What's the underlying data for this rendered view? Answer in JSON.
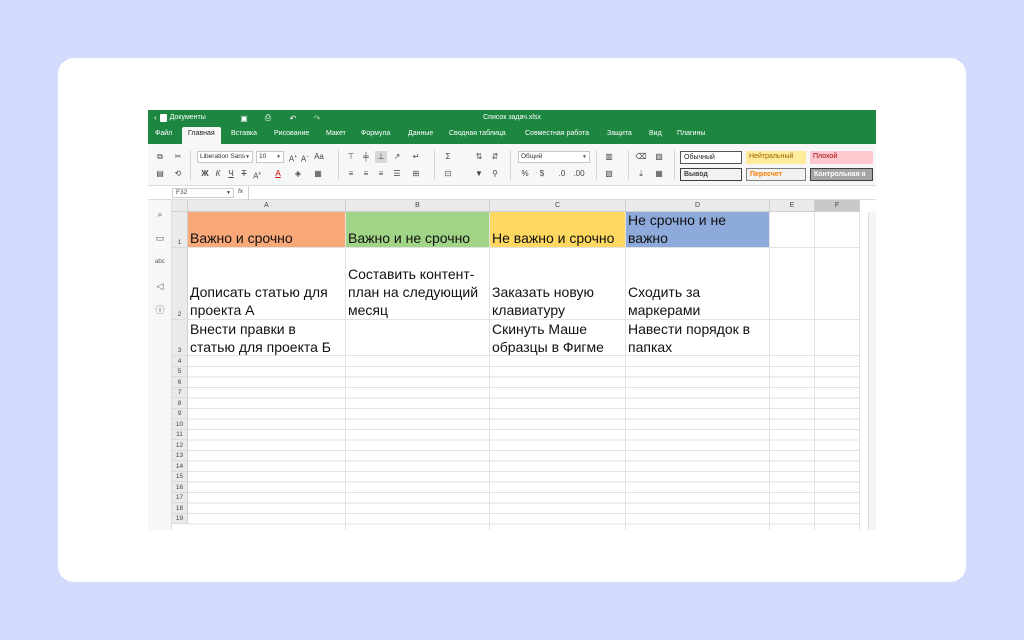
{
  "app": {
    "back_label": "Документы",
    "title": "Список задач.xlsx"
  },
  "menu": {
    "tabs": [
      "Файл",
      "Главная",
      "Вставка",
      "Рисование",
      "Макет",
      "Формула",
      "Данные",
      "Сводная таблица",
      "Совместная работа",
      "Защита",
      "Вид",
      "Плагины"
    ],
    "active_tab": "Главная"
  },
  "toolbar": {
    "font_name": "Liberation Sans",
    "font_size": "10",
    "number_format": "Общий",
    "styles": [
      {
        "label": "Обычный",
        "bg": "#ffffff",
        "fg": "#222222",
        "border": "#555555"
      },
      {
        "label": "Нейтральный",
        "bg": "#ffeb9c",
        "fg": "#9c6500",
        "border": "#ffeb9c"
      },
      {
        "label": "Плохой",
        "bg": "#ffc7ce",
        "fg": "#9c0006",
        "border": "#ffc7ce"
      },
      {
        "label": "Вывод",
        "bg": "#f2f2f2",
        "fg": "#3f3f3f",
        "border": "#3f3f3f"
      },
      {
        "label": "Пересчет",
        "bg": "#f2f2f2",
        "fg": "#fa7d00",
        "border": "#7f7f7f"
      },
      {
        "label": "Контрольная я",
        "bg": "#a5a5a5",
        "fg": "#ffffff",
        "border": "#3f3f3f"
      }
    ]
  },
  "formula_bar": {
    "cell_ref": "F32",
    "fx": "fx",
    "value": ""
  },
  "sheet": {
    "columns": [
      "A",
      "B",
      "C",
      "D",
      "E",
      "F"
    ],
    "selected_column": "F",
    "row_numbers": [
      "1",
      "2",
      "3",
      "4",
      "5",
      "6",
      "7",
      "8",
      "9",
      "10",
      "11",
      "12",
      "13",
      "14",
      "15",
      "16",
      "17",
      "18",
      "19"
    ],
    "header_colors": {
      "A": "#f9a878",
      "B": "#a0d486",
      "C": "#fed860",
      "D": "#8eaadb"
    },
    "rows": [
      [
        "Важно и срочно",
        "Важно и не срочно",
        "Не важно и срочно",
        "Не срочно и не важно",
        "",
        ""
      ],
      [
        "Дописать статью для проекта А",
        "Составить контент-план на следующий месяц",
        "Заказать новую клавиатуру",
        "Сходить за маркерами",
        "",
        ""
      ],
      [
        "Внести правки в статью для проекта Б",
        "",
        "Скинуть Маше образцы в Фигме",
        "Навести порядок в папках",
        "",
        ""
      ]
    ]
  }
}
